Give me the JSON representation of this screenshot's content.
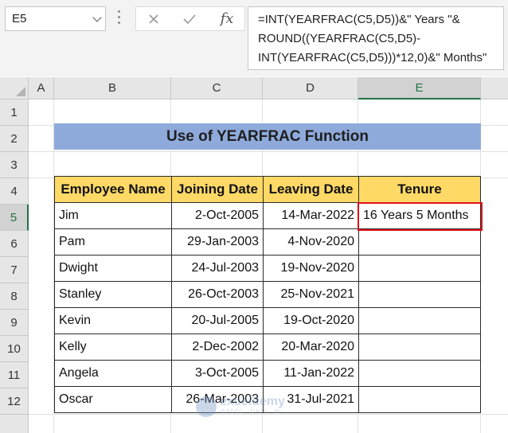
{
  "name_box": "E5",
  "formula_lines": [
    "=INT(YEARFRAC(C5,D5))&\" Years \"&",
    "ROUND((YEARFRAC(C5,D5)-",
    "INT(YEARFRAC(C5,D5)))*12,0)&\" Months\""
  ],
  "formula_buttons": {
    "fx": "fx"
  },
  "columns": [
    "A",
    "B",
    "C",
    "D",
    "E"
  ],
  "rows": [
    "1",
    "2",
    "3",
    "4",
    "5",
    "6",
    "7",
    "8",
    "9",
    "10",
    "11",
    "12"
  ],
  "title": "Use of YEARFRAC Function",
  "table": {
    "headers": [
      "Employee Name",
      "Joining Date",
      "Leaving Date",
      "Tenure"
    ],
    "rows": [
      [
        "Jim",
        "2-Oct-2005",
        "14-Mar-2022",
        "16 Years 5 Months"
      ],
      [
        "Pam",
        "29-Jan-2003",
        "4-Nov-2020",
        ""
      ],
      [
        "Dwight",
        "24-Jul-2003",
        "19-Nov-2020",
        ""
      ],
      [
        "Stanley",
        "26-Oct-2003",
        "25-Nov-2021",
        ""
      ],
      [
        "Kevin",
        "20-Jul-2005",
        "19-Oct-2020",
        ""
      ],
      [
        "Kelly",
        "2-Dec-2002",
        "20-Mar-2020",
        ""
      ],
      [
        "Angela",
        "3-Oct-2005",
        "11-Jan-2022",
        ""
      ],
      [
        "Oscar",
        "26-Mar-2003",
        "31-Jul-2021",
        ""
      ]
    ]
  },
  "watermark": {
    "name": "exceldemy",
    "tagline": "EXCEL · DATA · BI"
  },
  "colors": {
    "title_fill": "#8eaadb",
    "header_fill": "#ffd966",
    "selection": "#e0101a",
    "excel_green": "#217346"
  }
}
